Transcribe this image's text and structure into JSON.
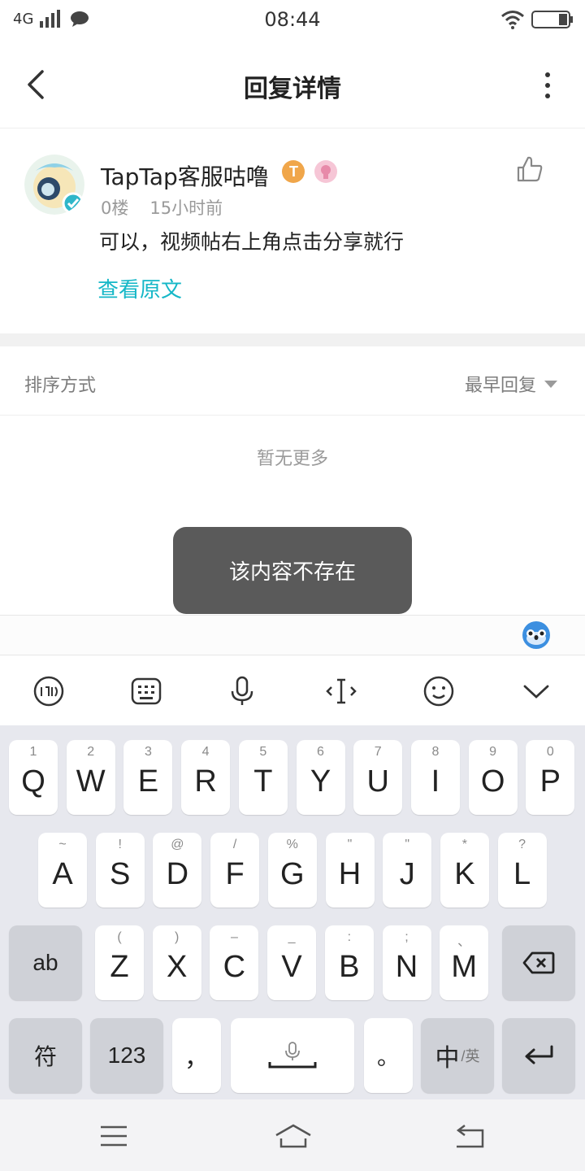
{
  "status_bar": {
    "network": "4G",
    "time": "08:44"
  },
  "header": {
    "title": "回复详情"
  },
  "reply": {
    "username": "TapTap客服咕噜",
    "floor": "0楼",
    "time_ago": "15小时前",
    "content": "可以，视频帖右上角点击分享就行",
    "view_original": "查看原文"
  },
  "sort": {
    "label": "排序方式",
    "value": "最早回复"
  },
  "empty_text": "暂无更多",
  "toast": "该内容不存在",
  "keyboard": {
    "row1": [
      {
        "k": "Q",
        "s": "1"
      },
      {
        "k": "W",
        "s": "2"
      },
      {
        "k": "E",
        "s": "3"
      },
      {
        "k": "R",
        "s": "4"
      },
      {
        "k": "T",
        "s": "5"
      },
      {
        "k": "Y",
        "s": "6"
      },
      {
        "k": "U",
        "s": "7"
      },
      {
        "k": "I",
        "s": "8"
      },
      {
        "k": "O",
        "s": "9"
      },
      {
        "k": "P",
        "s": "0"
      }
    ],
    "row2": [
      {
        "k": "A",
        "s": "~"
      },
      {
        "k": "S",
        "s": "!"
      },
      {
        "k": "D",
        "s": "@"
      },
      {
        "k": "F",
        "s": "/"
      },
      {
        "k": "G",
        "s": "%"
      },
      {
        "k": "H",
        "s": "\""
      },
      {
        "k": "J",
        "s": "\""
      },
      {
        "k": "K",
        "s": "*"
      },
      {
        "k": "L",
        "s": "?"
      }
    ],
    "row3": [
      {
        "k": "Z",
        "s": "("
      },
      {
        "k": "X",
        "s": ")"
      },
      {
        "k": "C",
        "s": "–"
      },
      {
        "k": "V",
        "s": "_"
      },
      {
        "k": "B",
        "s": ":"
      },
      {
        "k": "N",
        "s": ";"
      },
      {
        "k": "M",
        "s": "、"
      }
    ],
    "ab_key": "ab",
    "symbol_key": "符",
    "num_key": "123",
    "comma_key": "，",
    "period_key": "。",
    "lang_key_main": "中",
    "lang_key_sub": "/英"
  },
  "colors": {
    "accent": "#15b7c7",
    "toast_bg": "#5a5a5a"
  },
  "icons": {
    "back": "chevron-left-icon",
    "more": "more-vertical-icon",
    "like": "thumbs-up-icon",
    "delete": "backspace-icon",
    "enter": "enter-icon"
  }
}
